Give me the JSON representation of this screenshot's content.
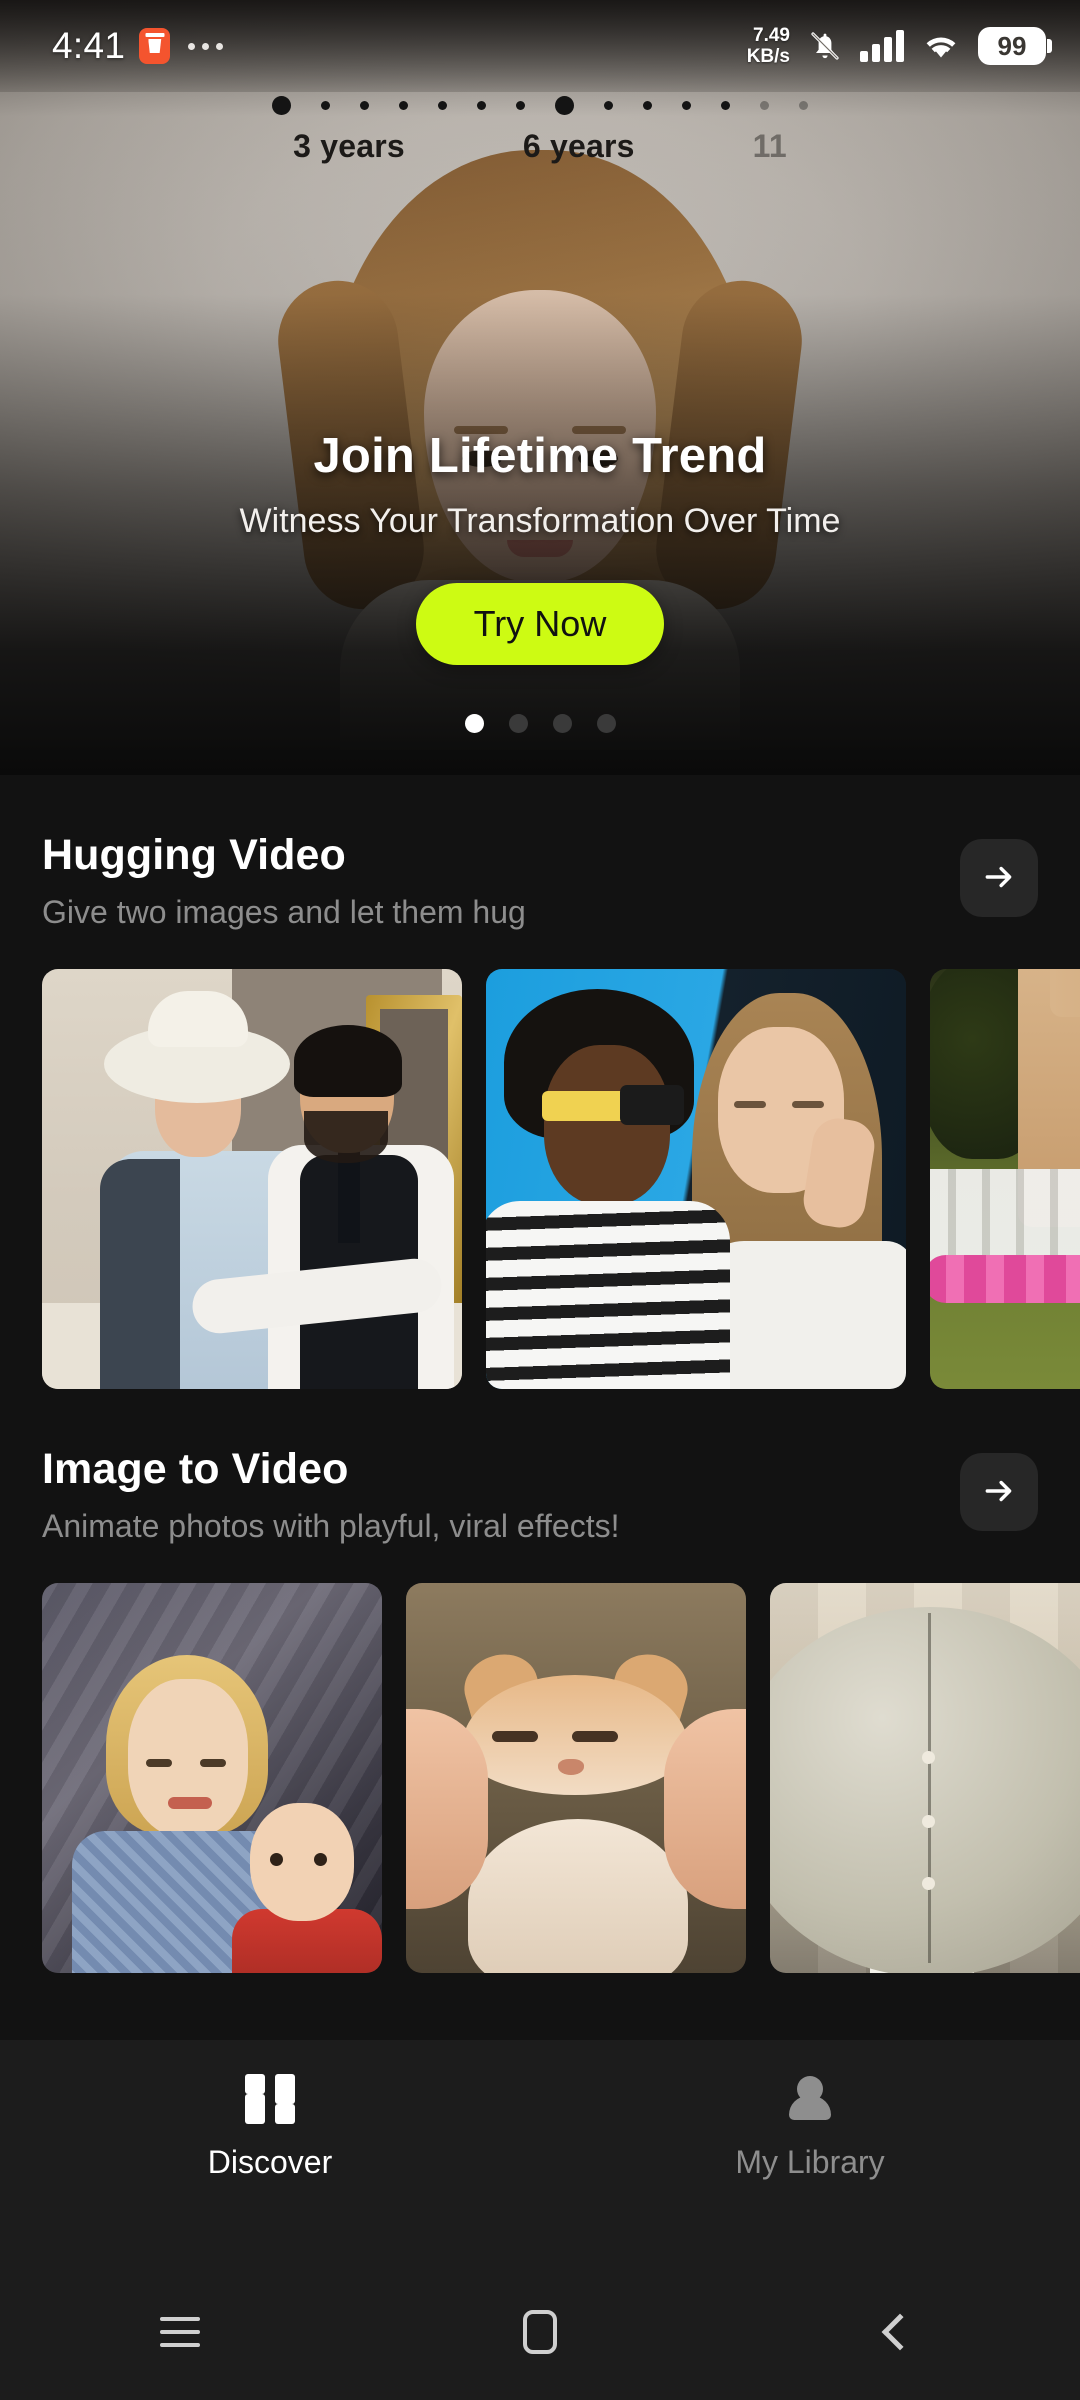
{
  "status_bar": {
    "time": "4:41",
    "trash_icon": "trash-icon",
    "overflow_icon": "more-dots-icon",
    "network_speed_value": "7.49",
    "network_speed_unit": "KB/s",
    "bell_icon": "bell-muted-icon",
    "signal_icon": "cellular-signal-icon",
    "wifi_icon": "wifi-icon",
    "battery_level": "99"
  },
  "hero": {
    "timeline_labels": [
      "3 years",
      "6 years",
      "11"
    ],
    "title": "Join Lifetime Trend",
    "subtitle": "Witness Your Transformation Over Time",
    "cta_label": "Try Now",
    "accent_color": "#cdfb13",
    "carousel": {
      "total": 4,
      "active_index": 0
    }
  },
  "sections": [
    {
      "id": "hugging-video",
      "title": "Hugging Video",
      "subtitle": "Give two images and let them hug",
      "arrow_icon": "arrow-right-icon",
      "cards": [
        {
          "id": "hug-card-1",
          "alt": "Couple embracing indoors, woman in white hat, man in black vest and tie"
        },
        {
          "id": "hug-card-2",
          "alt": "Man with yellow sunglasses in striped shirt beside woman in white top on blue background"
        },
        {
          "id": "hug-card-3",
          "alt": "Outdoor wedding with floral arch, white chairs and bride's dress"
        }
      ]
    },
    {
      "id": "image-to-video",
      "title": "Image to Video",
      "subtitle": "Animate photos with playful, viral effects!",
      "arrow_icon": "arrow-right-icon",
      "cards": [
        {
          "id": "i2v-card-1",
          "alt": "Vintage photo of blonde woman in plaid shirt holding a baby in red"
        },
        {
          "id": "i2v-card-2",
          "alt": "Orange tabby kitten face squished between two hands"
        },
        {
          "id": "i2v-card-3",
          "alt": "Person inflated into a large balloon shape in front of a building"
        }
      ]
    }
  ],
  "tab_bar": {
    "tabs": [
      {
        "id": "discover",
        "label": "Discover",
        "icon": "grid-icon",
        "active": true
      },
      {
        "id": "my-library",
        "label": "My Library",
        "icon": "person-icon",
        "active": false
      }
    ]
  },
  "android_nav": {
    "recents_icon": "recents-icon",
    "home_icon": "home-icon",
    "back_icon": "back-icon"
  }
}
